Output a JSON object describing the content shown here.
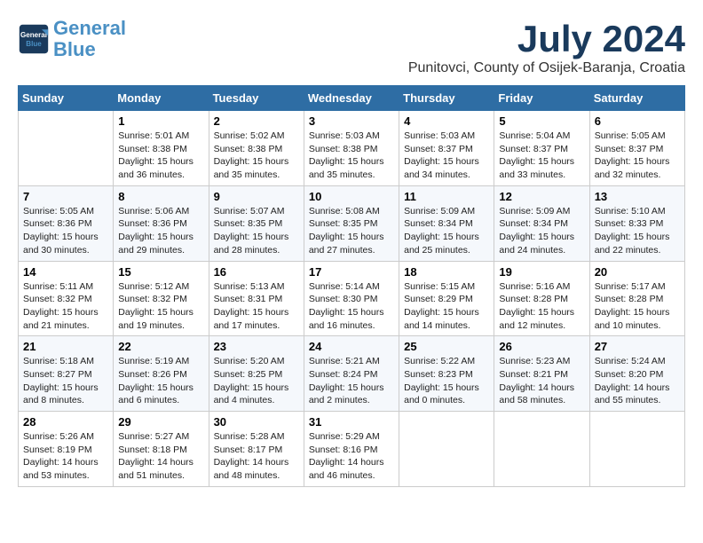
{
  "header": {
    "logo_line1": "General",
    "logo_line2": "Blue",
    "month": "July 2024",
    "location": "Punitovci, County of Osijek-Baranja, Croatia"
  },
  "days_of_week": [
    "Sunday",
    "Monday",
    "Tuesday",
    "Wednesday",
    "Thursday",
    "Friday",
    "Saturday"
  ],
  "weeks": [
    [
      {
        "day": "",
        "info": ""
      },
      {
        "day": "1",
        "info": "Sunrise: 5:01 AM\nSunset: 8:38 PM\nDaylight: 15 hours\nand 36 minutes."
      },
      {
        "day": "2",
        "info": "Sunrise: 5:02 AM\nSunset: 8:38 PM\nDaylight: 15 hours\nand 35 minutes."
      },
      {
        "day": "3",
        "info": "Sunrise: 5:03 AM\nSunset: 8:38 PM\nDaylight: 15 hours\nand 35 minutes."
      },
      {
        "day": "4",
        "info": "Sunrise: 5:03 AM\nSunset: 8:37 PM\nDaylight: 15 hours\nand 34 minutes."
      },
      {
        "day": "5",
        "info": "Sunrise: 5:04 AM\nSunset: 8:37 PM\nDaylight: 15 hours\nand 33 minutes."
      },
      {
        "day": "6",
        "info": "Sunrise: 5:05 AM\nSunset: 8:37 PM\nDaylight: 15 hours\nand 32 minutes."
      }
    ],
    [
      {
        "day": "7",
        "info": "Sunrise: 5:05 AM\nSunset: 8:36 PM\nDaylight: 15 hours\nand 30 minutes."
      },
      {
        "day": "8",
        "info": "Sunrise: 5:06 AM\nSunset: 8:36 PM\nDaylight: 15 hours\nand 29 minutes."
      },
      {
        "day": "9",
        "info": "Sunrise: 5:07 AM\nSunset: 8:35 PM\nDaylight: 15 hours\nand 28 minutes."
      },
      {
        "day": "10",
        "info": "Sunrise: 5:08 AM\nSunset: 8:35 PM\nDaylight: 15 hours\nand 27 minutes."
      },
      {
        "day": "11",
        "info": "Sunrise: 5:09 AM\nSunset: 8:34 PM\nDaylight: 15 hours\nand 25 minutes."
      },
      {
        "day": "12",
        "info": "Sunrise: 5:09 AM\nSunset: 8:34 PM\nDaylight: 15 hours\nand 24 minutes."
      },
      {
        "day": "13",
        "info": "Sunrise: 5:10 AM\nSunset: 8:33 PM\nDaylight: 15 hours\nand 22 minutes."
      }
    ],
    [
      {
        "day": "14",
        "info": "Sunrise: 5:11 AM\nSunset: 8:32 PM\nDaylight: 15 hours\nand 21 minutes."
      },
      {
        "day": "15",
        "info": "Sunrise: 5:12 AM\nSunset: 8:32 PM\nDaylight: 15 hours\nand 19 minutes."
      },
      {
        "day": "16",
        "info": "Sunrise: 5:13 AM\nSunset: 8:31 PM\nDaylight: 15 hours\nand 17 minutes."
      },
      {
        "day": "17",
        "info": "Sunrise: 5:14 AM\nSunset: 8:30 PM\nDaylight: 15 hours\nand 16 minutes."
      },
      {
        "day": "18",
        "info": "Sunrise: 5:15 AM\nSunset: 8:29 PM\nDaylight: 15 hours\nand 14 minutes."
      },
      {
        "day": "19",
        "info": "Sunrise: 5:16 AM\nSunset: 8:28 PM\nDaylight: 15 hours\nand 12 minutes."
      },
      {
        "day": "20",
        "info": "Sunrise: 5:17 AM\nSunset: 8:28 PM\nDaylight: 15 hours\nand 10 minutes."
      }
    ],
    [
      {
        "day": "21",
        "info": "Sunrise: 5:18 AM\nSunset: 8:27 PM\nDaylight: 15 hours\nand 8 minutes."
      },
      {
        "day": "22",
        "info": "Sunrise: 5:19 AM\nSunset: 8:26 PM\nDaylight: 15 hours\nand 6 minutes."
      },
      {
        "day": "23",
        "info": "Sunrise: 5:20 AM\nSunset: 8:25 PM\nDaylight: 15 hours\nand 4 minutes."
      },
      {
        "day": "24",
        "info": "Sunrise: 5:21 AM\nSunset: 8:24 PM\nDaylight: 15 hours\nand 2 minutes."
      },
      {
        "day": "25",
        "info": "Sunrise: 5:22 AM\nSunset: 8:23 PM\nDaylight: 15 hours\nand 0 minutes."
      },
      {
        "day": "26",
        "info": "Sunrise: 5:23 AM\nSunset: 8:21 PM\nDaylight: 14 hours\nand 58 minutes."
      },
      {
        "day": "27",
        "info": "Sunrise: 5:24 AM\nSunset: 8:20 PM\nDaylight: 14 hours\nand 55 minutes."
      }
    ],
    [
      {
        "day": "28",
        "info": "Sunrise: 5:26 AM\nSunset: 8:19 PM\nDaylight: 14 hours\nand 53 minutes."
      },
      {
        "day": "29",
        "info": "Sunrise: 5:27 AM\nSunset: 8:18 PM\nDaylight: 14 hours\nand 51 minutes."
      },
      {
        "day": "30",
        "info": "Sunrise: 5:28 AM\nSunset: 8:17 PM\nDaylight: 14 hours\nand 48 minutes."
      },
      {
        "day": "31",
        "info": "Sunrise: 5:29 AM\nSunset: 8:16 PM\nDaylight: 14 hours\nand 46 minutes."
      },
      {
        "day": "",
        "info": ""
      },
      {
        "day": "",
        "info": ""
      },
      {
        "day": "",
        "info": ""
      }
    ]
  ]
}
